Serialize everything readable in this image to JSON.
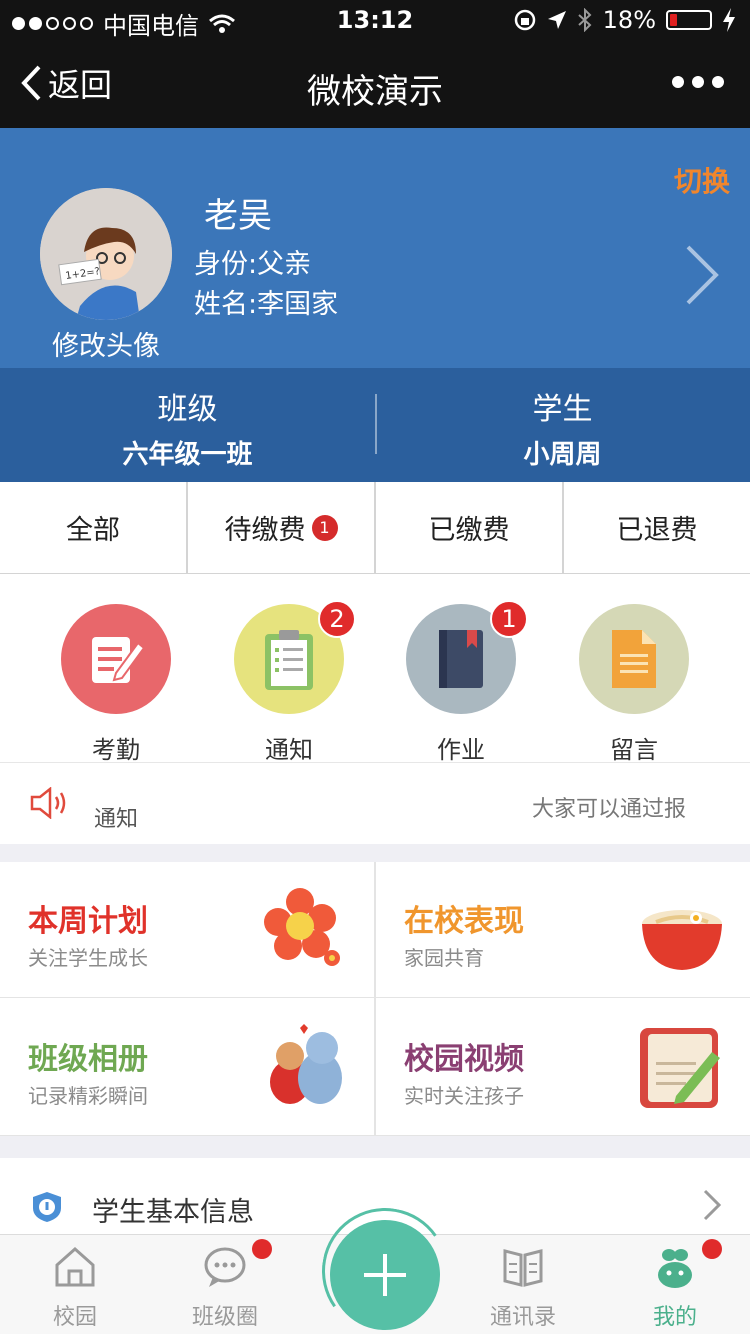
{
  "status_bar": {
    "carrier": "中国电信",
    "time": "13:12",
    "battery": "18%",
    "battery_level": 0.18
  },
  "nav": {
    "back_label": "返回",
    "title": "微校演示"
  },
  "profile": {
    "name": "老吴",
    "identity": "身份:父亲",
    "student_name": "姓名:李国家",
    "avatar_caption": "修改头像",
    "switch_label": "切换",
    "avatar_card_text": "1+2=?"
  },
  "class_info": {
    "class_label": "班级",
    "class_value": "六年级一班",
    "student_label": "学生",
    "student_value": "小周周"
  },
  "fee_tabs": [
    {
      "label": "全部",
      "badge": ""
    },
    {
      "label": "待缴费",
      "badge": "1"
    },
    {
      "label": "已缴费",
      "badge": ""
    },
    {
      "label": "已退费",
      "badge": ""
    }
  ],
  "quick_icons": [
    {
      "label": "考勤",
      "badge": "",
      "color": "#e8676b",
      "icon": "attendance-icon"
    },
    {
      "label": "通知",
      "badge": "2",
      "color": "#e6e37e",
      "icon": "clipboard-icon"
    },
    {
      "label": "作业",
      "badge": "1",
      "color": "#aab8c0",
      "icon": "book-icon"
    },
    {
      "label": "留言",
      "badge": "",
      "color": "#d5d8b6",
      "icon": "document-icon"
    }
  ],
  "notice": {
    "label": "通知",
    "text": "大家可以通过报"
  },
  "features": [
    {
      "title": "本周计划",
      "subtitle": "关注学生成长",
      "color": "#e0322a",
      "icon": "flower-icon"
    },
    {
      "title": "在校表现",
      "subtitle": "家园共育",
      "color": "#f0962d",
      "icon": "noodle-bowl-icon"
    },
    {
      "title": "班级相册",
      "subtitle": "记录精彩瞬间",
      "color": "#6fa852",
      "icon": "bears-icon"
    },
    {
      "title": "校园视频",
      "subtitle": "实时关注孩子",
      "color": "#8a3f72",
      "icon": "notebook-pencil-icon"
    }
  ],
  "info_row": {
    "label": "学生基本信息"
  },
  "tab_bar": [
    {
      "label": "校园",
      "active": false,
      "dot": false
    },
    {
      "label": "班级圈",
      "active": false,
      "dot": true
    },
    {
      "label": "通讯录",
      "active": false,
      "dot": false
    },
    {
      "label": "我的",
      "active": true,
      "dot": true
    }
  ],
  "colors": {
    "profile_bg": "#3b76b9",
    "class_bg": "#2b5f9d",
    "switch": "#f0862d",
    "accent_green": "#56c0a6",
    "badge_red": "#e02b2b"
  }
}
